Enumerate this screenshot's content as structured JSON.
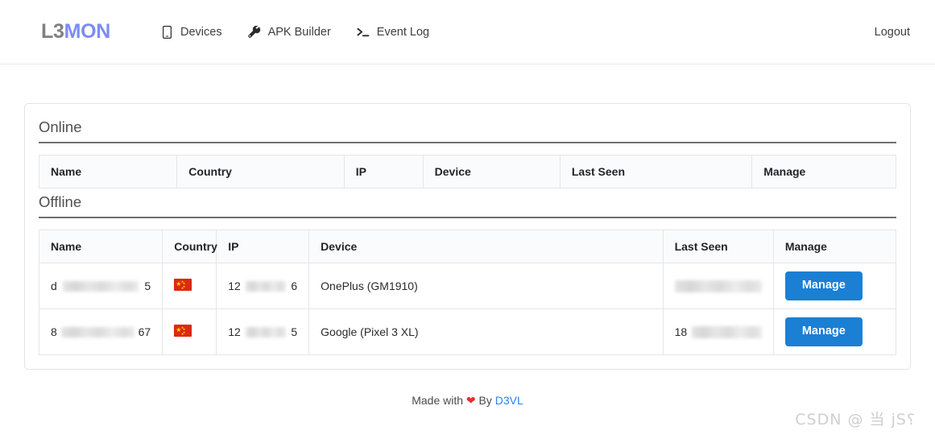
{
  "navbar": {
    "brand": {
      "part1": "L3",
      "part2": "MON"
    },
    "links": [
      {
        "icon": "mobile-phone-icon",
        "label": "Devices"
      },
      {
        "icon": "wrench-icon",
        "label": "APK Builder"
      },
      {
        "icon": "terminal-icon",
        "label": "Event Log"
      }
    ],
    "logout_label": "Logout"
  },
  "sections": {
    "online": {
      "title": "Online",
      "columns": [
        "Name",
        "Country",
        "IP",
        "Device",
        "Last Seen",
        "Manage"
      ],
      "rows": []
    },
    "offline": {
      "title": "Offline",
      "columns": [
        "Name",
        "Country",
        "IP",
        "Device",
        "Last Seen",
        "Manage"
      ],
      "rows": [
        {
          "name_prefix": "d",
          "name_suffix": "5",
          "country": "CN",
          "ip_prefix": "12",
          "ip_suffix": "6",
          "device": "OnePlus (GM1910)",
          "last_seen_prefix": "",
          "manage_label": "Manage"
        },
        {
          "name_prefix": "8",
          "name_suffix": "67",
          "country": "CN",
          "ip_prefix": "12",
          "ip_suffix": "5",
          "device": "Google (Pixel 3 XL)",
          "last_seen_prefix": "18",
          "manage_label": "Manage"
        }
      ]
    }
  },
  "footer": {
    "made_with": "Made with",
    "heart": "❤",
    "by": "By",
    "author": "D3VL"
  },
  "watermark": "CSDN @ 当 jS⸮",
  "colors": {
    "brand_accent": "#7b8cf5",
    "brand_gray": "#808080",
    "button_blue": "#1b7fd4",
    "link_blue": "#2d7ff9",
    "heart_red": "#e03030",
    "flag_red": "#de2910",
    "flag_yellow": "#ffde00"
  }
}
